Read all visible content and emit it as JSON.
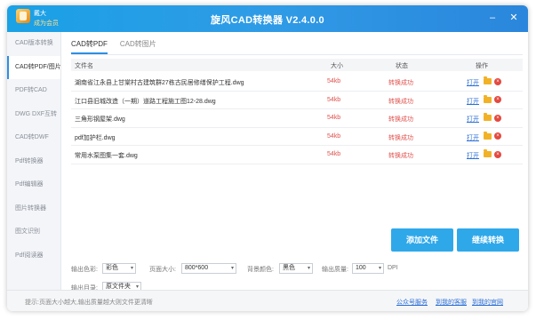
{
  "window": {
    "title": "旋风CAD转换器 V2.4.0.0",
    "user_name": "戴大",
    "member_label": "成为会员"
  },
  "sidebar": {
    "items": [
      {
        "label": "CAD版本转换",
        "active": false
      },
      {
        "label": "CAD转PDF/图片",
        "active": true
      },
      {
        "label": "PDF转CAD",
        "active": false
      },
      {
        "label": "DWG DXF互转",
        "active": false
      },
      {
        "label": "CAD转DWF",
        "active": false
      },
      {
        "label": "Pdf转换器",
        "active": false
      },
      {
        "label": "Pdf编辑器",
        "active": false
      },
      {
        "label": "图片转换器",
        "active": false
      },
      {
        "label": "图文识别",
        "active": false
      },
      {
        "label": "Pdf阅读器",
        "active": false
      }
    ]
  },
  "tabs": [
    {
      "label": "CAD转PDF",
      "active": true
    },
    {
      "label": "CAD转图片",
      "active": false
    }
  ],
  "table": {
    "headers": {
      "name": "文件名",
      "size": "大小",
      "status": "状态",
      "action": "操作"
    },
    "rows": [
      {
        "name": "湖南省江永县上甘棠村古建筑群27栋古民居修缮保护工程.dwg",
        "size": "54kb",
        "status": "转换成功",
        "open": "打开"
      },
      {
        "name": "江口县旧城改造（一期）道路工程施工图12-28.dwg",
        "size": "54kb",
        "status": "转换成功",
        "open": "打开"
      },
      {
        "name": "三角形钢屋架.dwg",
        "size": "54kb",
        "status": "转换成功",
        "open": "打开"
      },
      {
        "name": "pdf加护栏.dwg",
        "size": "54kb",
        "status": "转换成功",
        "open": "打开"
      },
      {
        "name": "常用水泵图集一套.dwg",
        "size": "54kb",
        "status": "转换成功",
        "open": "打开"
      }
    ]
  },
  "actions": {
    "add_file": "添加文件",
    "continue_convert": "继续转换"
  },
  "options": {
    "color_label": "输出色彩:",
    "color_value": "彩色",
    "page_size_label": "页面大小:",
    "page_size_value": "800*600",
    "bg_label": "背景颜色:",
    "bg_value": "黑色",
    "quality_label": "输出质量:",
    "quality_value": "100",
    "dpi_label": "DPI",
    "dir_label": "输出目录:",
    "dir_value": "原文件夹"
  },
  "footer": {
    "tip": "提示:页面大小越大,输出质量越大则文件更清晰",
    "links": [
      "公众号服务",
      "到我的客服",
      "到我的官网"
    ]
  },
  "colors": {
    "accent": "#2b8fe4",
    "title_bar": "#2f9be6",
    "success_text": "#e0514c",
    "button": "#2fa8ea"
  }
}
